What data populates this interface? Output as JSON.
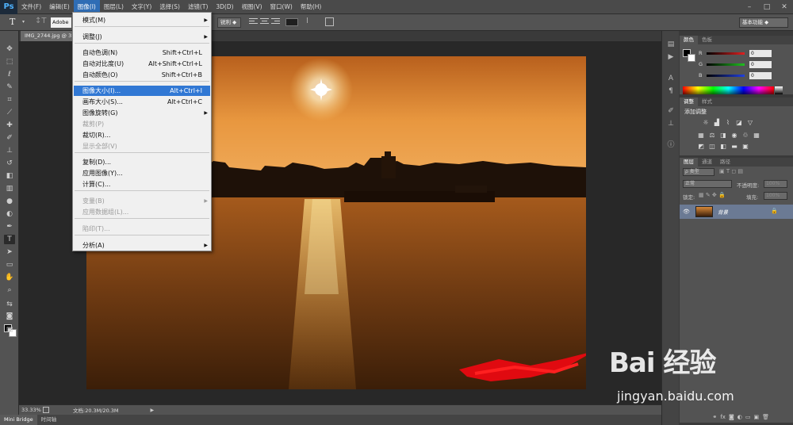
{
  "app": {
    "logo": "Ps",
    "menus": [
      "文件(F)",
      "编辑(E)",
      "图像(I)",
      "图层(L)",
      "文字(Y)",
      "选择(S)",
      "滤镜(T)",
      "3D(D)",
      "视图(V)",
      "窗口(W)",
      "帮助(H)"
    ],
    "active_menu_index": 2
  },
  "options_bar": {
    "font_family": "Adobe",
    "antialias": "锐利",
    "workspace": "基本功能"
  },
  "document": {
    "tab": "IMG_2744.jpg @ 3",
    "zoom": "33.33%",
    "doc_info": "文档:20.3M/20.3M"
  },
  "bottom_tabs": [
    "Mini Bridge",
    "时间轴"
  ],
  "image_menu": {
    "items": [
      {
        "label": "模式(M)",
        "shortcut": "",
        "submenu": true,
        "disabled": false,
        "highlighted": false
      },
      {
        "label": "调整(J)",
        "shortcut": "",
        "submenu": true,
        "disabled": false,
        "highlighted": false
      },
      {
        "label": "自动色调(N)",
        "shortcut": "Shift+Ctrl+L",
        "submenu": false,
        "disabled": false,
        "highlighted": false
      },
      {
        "label": "自动对比度(U)",
        "shortcut": "Alt+Shift+Ctrl+L",
        "submenu": false,
        "disabled": false,
        "highlighted": false
      },
      {
        "label": "自动颜色(O)",
        "shortcut": "Shift+Ctrl+B",
        "submenu": false,
        "disabled": false,
        "highlighted": false
      },
      {
        "label": "图像大小(I)...",
        "shortcut": "Alt+Ctrl+I",
        "submenu": false,
        "disabled": false,
        "highlighted": true
      },
      {
        "label": "画布大小(S)...",
        "shortcut": "Alt+Ctrl+C",
        "submenu": false,
        "disabled": false,
        "highlighted": false
      },
      {
        "label": "图像旋转(G)",
        "shortcut": "",
        "submenu": true,
        "disabled": false,
        "highlighted": false
      },
      {
        "label": "裁剪(P)",
        "shortcut": "",
        "submenu": false,
        "disabled": true,
        "highlighted": false
      },
      {
        "label": "裁切(R)...",
        "shortcut": "",
        "submenu": false,
        "disabled": false,
        "highlighted": false
      },
      {
        "label": "显示全部(V)",
        "shortcut": "",
        "submenu": false,
        "disabled": true,
        "highlighted": false
      },
      {
        "label": "复制(D)...",
        "shortcut": "",
        "submenu": false,
        "disabled": false,
        "highlighted": false
      },
      {
        "label": "应用图像(Y)...",
        "shortcut": "",
        "submenu": false,
        "disabled": false,
        "highlighted": false
      },
      {
        "label": "计算(C)...",
        "shortcut": "",
        "submenu": false,
        "disabled": false,
        "highlighted": false
      },
      {
        "label": "变量(B)",
        "shortcut": "",
        "submenu": true,
        "disabled": true,
        "highlighted": false
      },
      {
        "label": "应用数据组(L)...",
        "shortcut": "",
        "submenu": false,
        "disabled": true,
        "highlighted": false
      },
      {
        "label": "陷印(T)...",
        "shortcut": "",
        "submenu": false,
        "disabled": true,
        "highlighted": false
      },
      {
        "label": "分析(A)",
        "shortcut": "",
        "submenu": true,
        "disabled": false,
        "highlighted": false
      }
    ]
  },
  "color_panel": {
    "tabs": [
      "颜色",
      "色板"
    ],
    "channels": [
      {
        "label": "R",
        "value": "0",
        "color": "#e02020"
      },
      {
        "label": "G",
        "value": "0",
        "color": "#20c020"
      },
      {
        "label": "B",
        "value": "0",
        "color": "#2040e0"
      }
    ]
  },
  "adjust_panel": {
    "tabs": [
      "调整",
      "样式"
    ],
    "title": "添加调整"
  },
  "layers_panel": {
    "tabs": [
      "图层",
      "通道",
      "路径"
    ],
    "kind_filter": "ρ 类型",
    "blend_mode": "正常",
    "opacity_label": "不透明度:",
    "opacity_value": "100%",
    "lock_label": "锁定:",
    "fill_label": "填充:",
    "fill_value": "100%",
    "layer_name": "背景"
  },
  "watermark": {
    "brand": "Bai 经验",
    "url": "jingyan.baidu.com"
  },
  "colors": {
    "menu_highlight": "#3178d4",
    "active_menu": "#2f6db5",
    "layer_selected": "#6b7a94"
  }
}
